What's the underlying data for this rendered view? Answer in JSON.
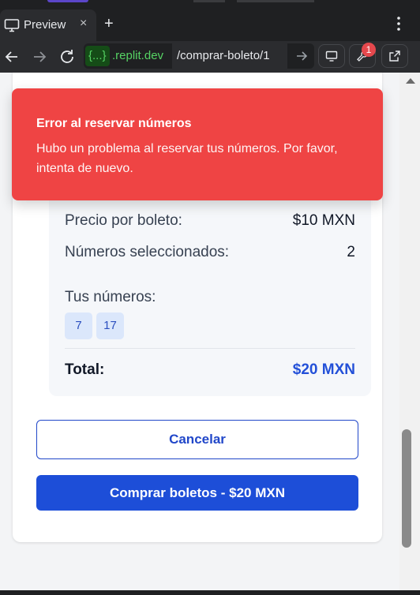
{
  "browser": {
    "tab_title": "Preview",
    "tab_close": "×",
    "new_tab": "+",
    "url_host_brace": "{...}",
    "url_host_rest": ".replit.dev",
    "url_path": "/comprar-boleto/1",
    "notification_count": "1",
    "icons": {
      "tab": "monitor-icon",
      "back": "arrow-left-icon",
      "forward": "arrow-right-icon",
      "reload": "reload-icon",
      "go": "arrow-right-icon",
      "devices": "monitor-icon",
      "tools": "wrench-icon",
      "open_external": "external-link-icon",
      "menu": "kebab-icon"
    }
  },
  "toast": {
    "title": "Error al reservar números",
    "message": "Hubo un problema al reservar tus números. Por favor, intenta de nuevo."
  },
  "summary": {
    "price_label": "Precio por boleto:",
    "price_value": "$10 MXN",
    "selected_label": "Números seleccionados:",
    "selected_value": "2",
    "your_numbers_label": "Tus números:",
    "numbers": [
      "7",
      "17"
    ],
    "total_label": "Total:",
    "total_value": "$20 MXN"
  },
  "actions": {
    "cancel_label": "Cancelar",
    "buy_label": "Comprar boletos - $20 MXN"
  },
  "colors": {
    "toast_bg": "#ef4444",
    "primary": "#1d4ed8",
    "total_accent": "#2350d8",
    "chip_bg": "#dbe7fb"
  }
}
